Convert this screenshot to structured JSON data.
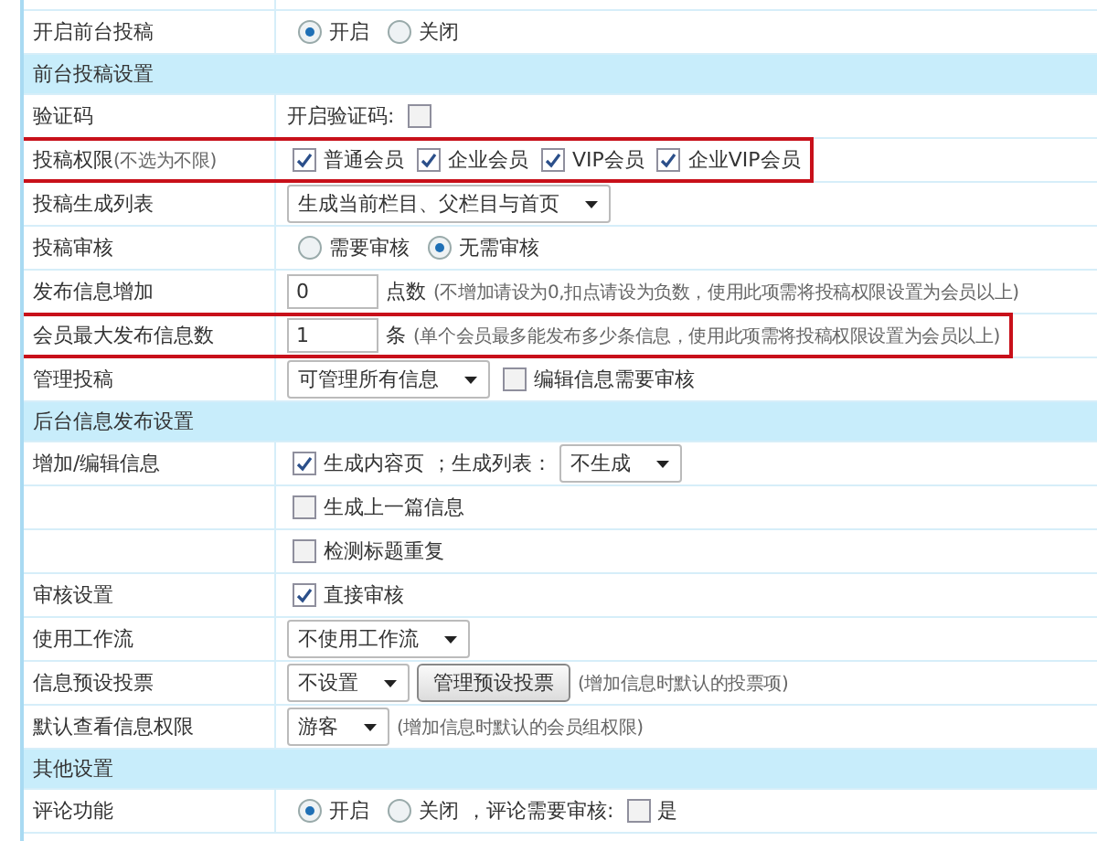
{
  "rows": [
    {
      "kind": "setting",
      "label": "开启前台投稿",
      "highlighted": false,
      "controls": [
        {
          "kind": "radio",
          "label": "开启",
          "selected": true
        },
        {
          "kind": "radio",
          "label": "关闭",
          "selected": false
        }
      ]
    },
    {
      "kind": "section",
      "label": "前台投稿设置"
    },
    {
      "kind": "setting",
      "label": "验证码",
      "highlighted": false,
      "controls": [
        {
          "kind": "text",
          "text": "开启验证码:"
        },
        {
          "kind": "checkbox",
          "checked": false
        }
      ]
    },
    {
      "kind": "setting",
      "label": "投稿权限",
      "note": "(不选为不限)",
      "highlighted": true,
      "controls": [
        {
          "kind": "checkbox",
          "label": "普通会员",
          "checked": true
        },
        {
          "kind": "checkbox",
          "label": "企业会员",
          "checked": true
        },
        {
          "kind": "checkbox",
          "label": "VIP会员",
          "checked": true
        },
        {
          "kind": "checkbox",
          "label": "企业VIP会员",
          "checked": true
        }
      ]
    },
    {
      "kind": "setting",
      "label": "投稿生成列表",
      "highlighted": false,
      "controls": [
        {
          "kind": "select",
          "value": "生成当前栏目、父栏目与首页"
        }
      ]
    },
    {
      "kind": "setting",
      "label": "投稿审核",
      "highlighted": false,
      "controls": [
        {
          "kind": "radio",
          "label": "需要审核",
          "selected": false
        },
        {
          "kind": "radio",
          "label": "无需审核",
          "selected": true
        }
      ]
    },
    {
      "kind": "setting",
      "label": "发布信息增加",
      "highlighted": false,
      "controls": [
        {
          "kind": "input",
          "value": "0"
        },
        {
          "kind": "text",
          "text": "点数"
        },
        {
          "kind": "note",
          "text": "(不增加请设为0,扣点请设为负数，使用此项需将投稿权限设置为会员以上)"
        }
      ]
    },
    {
      "kind": "setting",
      "label": "会员最大发布信息数",
      "highlighted": true,
      "controls": [
        {
          "kind": "input",
          "value": "1"
        },
        {
          "kind": "text",
          "text": "条"
        },
        {
          "kind": "note",
          "text": "(单个会员最多能发布多少条信息，使用此项需将投稿权限设置为会员以上)"
        }
      ]
    },
    {
      "kind": "setting",
      "label": "管理投稿",
      "highlighted": false,
      "controls": [
        {
          "kind": "select",
          "value": "可管理所有信息"
        },
        {
          "kind": "checkbox",
          "label": "编辑信息需要审核",
          "checked": false
        }
      ]
    },
    {
      "kind": "section",
      "label": "后台信息发布设置"
    },
    {
      "kind": "setting",
      "label": "增加/编辑信息",
      "highlighted": false,
      "controls": [
        {
          "kind": "checkbox",
          "label": "生成内容页",
          "checked": true
        },
        {
          "kind": "text",
          "text": "；生成列表："
        },
        {
          "kind": "select",
          "value": "不生成"
        }
      ]
    },
    {
      "kind": "setting",
      "highlighted": false,
      "controls": [
        {
          "kind": "checkbox",
          "label": "生成上一篇信息",
          "checked": false
        }
      ]
    },
    {
      "kind": "setting",
      "highlighted": false,
      "controls": [
        {
          "kind": "checkbox",
          "label": "检测标题重复",
          "checked": false
        }
      ]
    },
    {
      "kind": "setting",
      "label": "审核设置",
      "highlighted": false,
      "controls": [
        {
          "kind": "checkbox",
          "label": "直接审核",
          "checked": true
        }
      ]
    },
    {
      "kind": "setting",
      "label": "使用工作流",
      "highlighted": false,
      "controls": [
        {
          "kind": "select",
          "value": "不使用工作流"
        }
      ]
    },
    {
      "kind": "setting",
      "label": "信息预设投票",
      "highlighted": false,
      "controls": [
        {
          "kind": "select",
          "value": "不设置"
        },
        {
          "kind": "button",
          "label": "管理预设投票"
        },
        {
          "kind": "note",
          "text": "(增加信息时默认的投票项)"
        }
      ]
    },
    {
      "kind": "setting",
      "label": "默认查看信息权限",
      "highlighted": false,
      "controls": [
        {
          "kind": "select",
          "value": "游客"
        },
        {
          "kind": "note",
          "text": "(增加信息时默认的会员组权限)"
        }
      ]
    },
    {
      "kind": "section",
      "label": "其他设置"
    },
    {
      "kind": "setting",
      "label": "评论功能",
      "highlighted": false,
      "controls": [
        {
          "kind": "radio",
          "label": "开启",
          "selected": true
        },
        {
          "kind": "radio",
          "label": "关闭",
          "selected": false
        },
        {
          "kind": "text",
          "text": "，评论需要审核:"
        },
        {
          "kind": "checkbox",
          "label": "是",
          "checked": false
        }
      ]
    }
  ]
}
